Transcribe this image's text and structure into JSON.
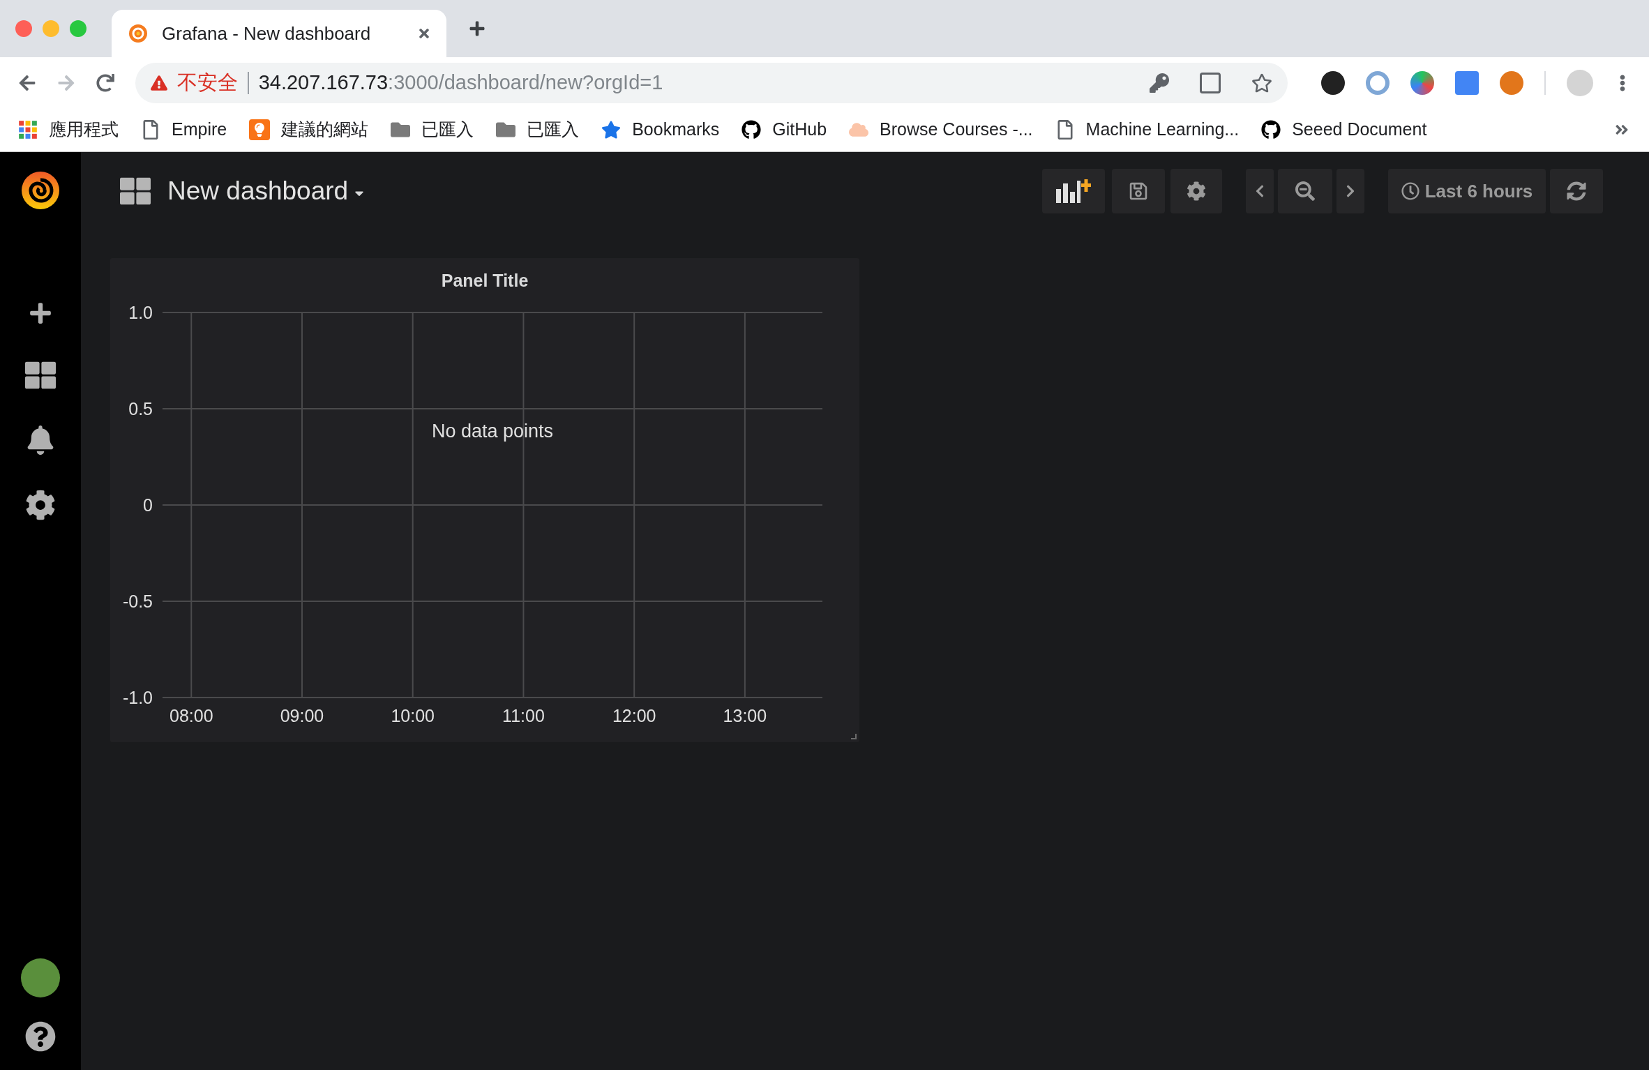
{
  "browser": {
    "tab": {
      "title": "Grafana - New dashboard"
    },
    "address": {
      "warning": "不安全",
      "host": "34.207.167.73",
      "path": ":3000/dashboard/new?orgId=1"
    },
    "bookmarks": [
      {
        "kind": "apps",
        "label": "應用程式"
      },
      {
        "kind": "page",
        "label": "Empire"
      },
      {
        "kind": "bulb",
        "label": "建議的網站"
      },
      {
        "kind": "folder",
        "label": "已匯入"
      },
      {
        "kind": "folder",
        "label": "已匯入"
      },
      {
        "kind": "star",
        "label": "Bookmarks"
      },
      {
        "kind": "github",
        "label": "GitHub"
      },
      {
        "kind": "cloud",
        "label": "Browse Courses -..."
      },
      {
        "kind": "page",
        "label": "Machine Learning..."
      },
      {
        "kind": "github",
        "label": "Seeed Document"
      }
    ]
  },
  "dashboard": {
    "title": "New dashboard",
    "time_range": "Last 6 hours"
  },
  "panel": {
    "chart_data": {
      "type": "line",
      "title": "Panel Title",
      "grid": true,
      "xlim": [
        7.74,
        13.7
      ],
      "ylim": [
        -1,
        1
      ],
      "xticks": [
        {
          "value": 8,
          "label": "08:00"
        },
        {
          "value": 9,
          "label": "09:00"
        },
        {
          "value": 10,
          "label": "10:00"
        },
        {
          "value": 11,
          "label": "11:00"
        },
        {
          "value": 12,
          "label": "12:00"
        },
        {
          "value": 13,
          "label": "13:00"
        }
      ],
      "yticks": [
        {
          "value": 1,
          "label": "1.0"
        },
        {
          "value": 0.5,
          "label": "0.5"
        },
        {
          "value": 0,
          "label": "0"
        },
        {
          "value": -0.5,
          "label": "-0.5"
        },
        {
          "value": -1,
          "label": "-1.0"
        }
      ],
      "annotations": [
        "No data points"
      ]
    }
  }
}
